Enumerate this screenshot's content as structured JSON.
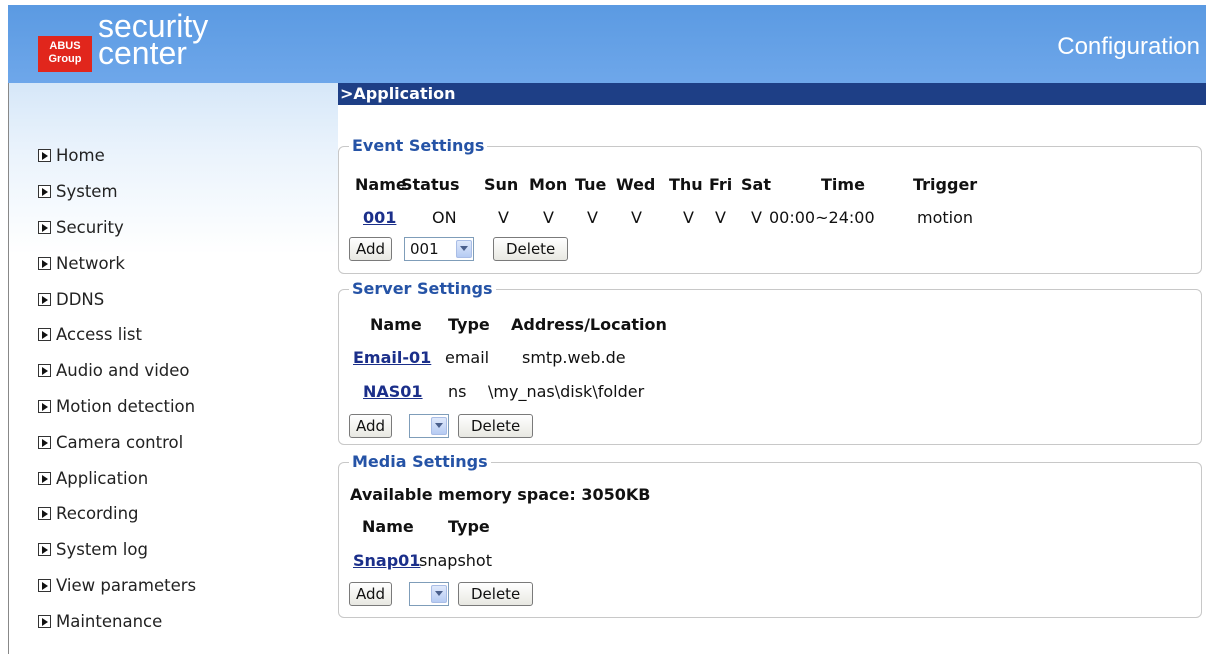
{
  "header": {
    "logo_line1": "ABUS",
    "logo_line2": "Group",
    "brand_line1": "security",
    "brand_line2": "center",
    "page_title": "Configuration"
  },
  "sidebar": {
    "items": [
      {
        "label": "Home"
      },
      {
        "label": "System"
      },
      {
        "label": "Security"
      },
      {
        "label": "Network"
      },
      {
        "label": "DDNS"
      },
      {
        "label": "Access list"
      },
      {
        "label": "Audio and video"
      },
      {
        "label": "Motion detection"
      },
      {
        "label": "Camera control"
      },
      {
        "label": "Application"
      },
      {
        "label": "Recording"
      },
      {
        "label": "System log"
      },
      {
        "label": "View parameters"
      },
      {
        "label": "Maintenance"
      }
    ]
  },
  "main": {
    "title": ">Application",
    "event": {
      "legend": "Event Settings",
      "headers": [
        "Name",
        "Status",
        "Sun",
        "Mon",
        "Tue",
        "Wed",
        "Thu",
        "Fri",
        "Sat",
        "Time",
        "Trigger"
      ],
      "row": {
        "name": "001",
        "status": "ON",
        "sun": "V",
        "mon": "V",
        "tue": "V",
        "wed": "V",
        "thu": "V",
        "fri": "V",
        "sat": "V",
        "time": "00:00~24:00",
        "trigger": "motion"
      },
      "add_label": "Add",
      "select_value": "001",
      "delete_label": "Delete"
    },
    "server": {
      "legend": "Server Settings",
      "headers": [
        "Name",
        "Type",
        "Address/Location"
      ],
      "rows": [
        {
          "name": "Email-01",
          "type": "email",
          "address": "smtp.web.de"
        },
        {
          "name": "NAS01",
          "type": "ns",
          "address": "\\my_nas\\disk\\folder"
        }
      ],
      "add_label": "Add",
      "select_value": "",
      "delete_label": "Delete"
    },
    "media": {
      "legend": "Media Settings",
      "memory_text": "Available memory space: 3050KB",
      "headers": [
        "Name",
        "Type"
      ],
      "rows": [
        {
          "name": "Snap01",
          "type": "snapshot"
        }
      ],
      "add_label": "Add",
      "select_value": "",
      "delete_label": "Delete"
    }
  },
  "colors": {
    "header_blue": "#6ea7ea",
    "titlebar_navy": "#1e3f86",
    "legend_blue": "#2553a6",
    "link_navy": "#1b2f8a",
    "logo_red": "#e1261c"
  }
}
